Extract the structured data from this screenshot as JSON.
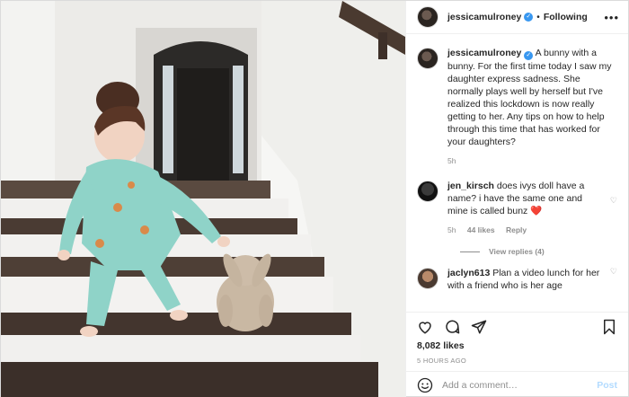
{
  "post": {
    "username": "jessicamulroney",
    "follow_status": "Following",
    "more_label": "•••"
  },
  "caption": {
    "username": "jessicamulroney",
    "text": "A bunny with a bunny. For the first time today I saw my daughter express sadness. She normally plays well by herself but I've realized this lockdown is now really getting to her. Any tips on how to help through this time that has worked for your daughters?",
    "age": "5h"
  },
  "comments": [
    {
      "username": "jen_kirsch",
      "text": "does ivys doll have a name? i have the same one and mine is called bunz ❤️",
      "age": "5h",
      "likes": "44 likes",
      "reply_label": "Reply",
      "view_replies": "View replies (4)"
    },
    {
      "username": "jaclyn613",
      "text": "Plan a video lunch for her with a friend who is her age"
    }
  ],
  "stats": {
    "likes": "8,082 likes",
    "time": "5 HOURS AGO"
  },
  "add_comment": {
    "placeholder": "Add a comment…",
    "post_label": "Post"
  },
  "icons": {
    "verified": "verified-badge-icon",
    "like": "heart-icon",
    "comment": "comment-icon",
    "share": "share-icon",
    "save": "bookmark-icon",
    "emoji": "emoji-icon"
  },
  "colors": {
    "verified": "#3897f0",
    "muted": "#8e8e8e",
    "post_button": "#b3dbff"
  }
}
